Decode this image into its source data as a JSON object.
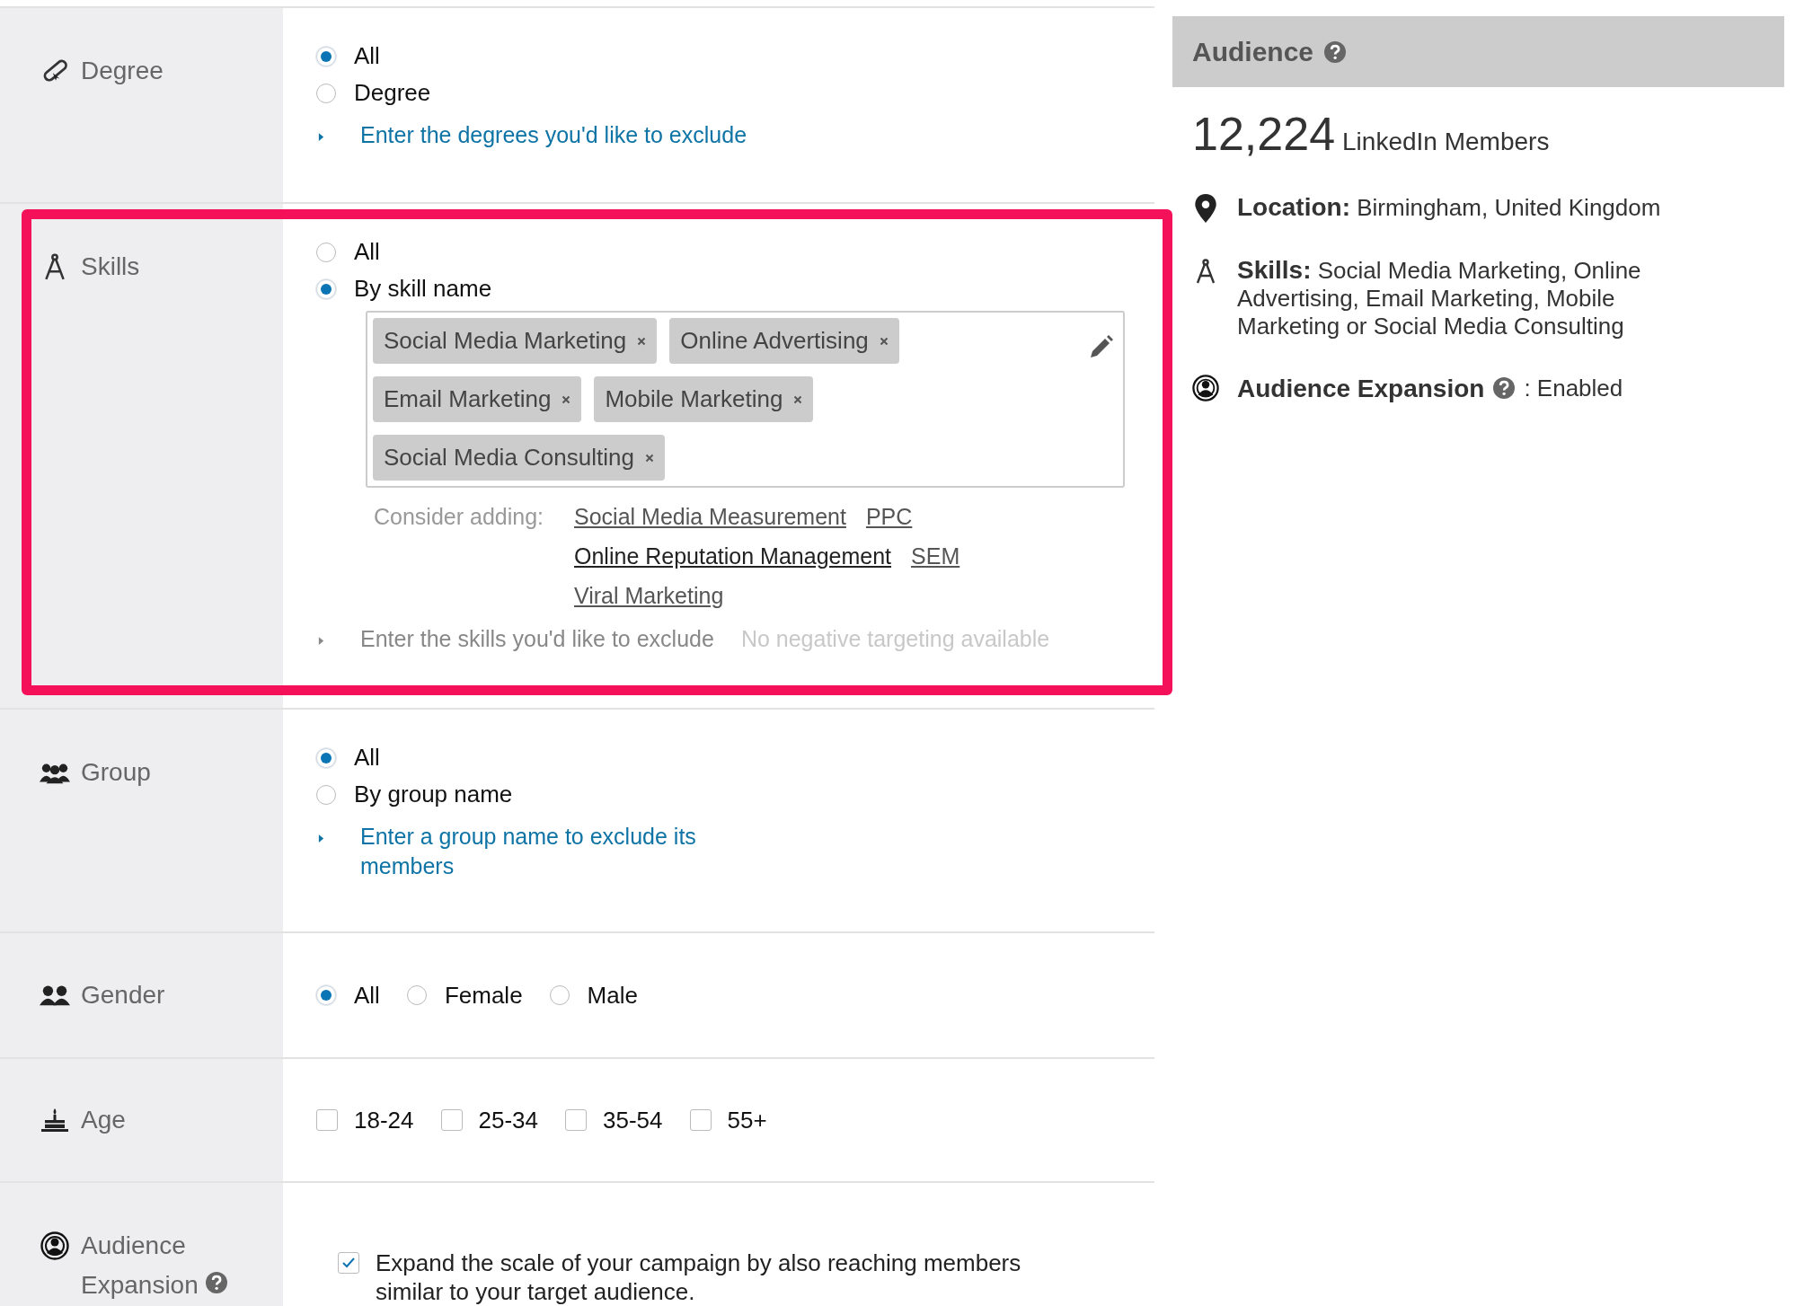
{
  "sections": [
    {
      "kind": "degree",
      "label": "Degree",
      "highlighted": false,
      "options": [
        {
          "label": "All",
          "selected": true
        },
        {
          "label": "Degree",
          "selected": false
        }
      ],
      "exclude": {
        "text": "Enter the degrees you'd like to exclude",
        "disabled": false
      }
    },
    {
      "kind": "skills",
      "label": "Skills",
      "highlighted": true,
      "options": [
        {
          "label": "All",
          "selected": false
        },
        {
          "label": "By skill name",
          "selected": true
        }
      ],
      "tags": [
        "Social Media Marketing",
        "Online Advertising",
        "Email Marketing",
        "Mobile Marketing",
        "Social Media Consulting"
      ],
      "suggestions_label": "Consider adding:",
      "suggestions": [
        {
          "text": "Social Media Measurement",
          "hover": false
        },
        {
          "text": "PPC",
          "hover": false
        },
        {
          "text": "Online Reputation Management",
          "hover": true
        },
        {
          "text": "SEM",
          "hover": false
        },
        {
          "text": "Viral Marketing",
          "hover": false
        }
      ],
      "exclude": {
        "text": "Enter the skills you'd like to exclude",
        "disabled": true
      },
      "exclude_note": "No negative targeting available"
    },
    {
      "kind": "group",
      "label": "Group",
      "highlighted": false,
      "options": [
        {
          "label": "All",
          "selected": true
        },
        {
          "label": "By group name",
          "selected": false
        }
      ],
      "exclude": {
        "text": "Enter a group name to exclude its members",
        "disabled": false
      }
    },
    {
      "kind": "gender",
      "label": "Gender",
      "highlighted": false,
      "options": [
        {
          "label": "All",
          "selected": true
        },
        {
          "label": "Female",
          "selected": false
        },
        {
          "label": "Male",
          "selected": false
        }
      ]
    },
    {
      "kind": "age",
      "label": "Age",
      "highlighted": false,
      "checkboxes": [
        {
          "label": "18-24",
          "checked": false
        },
        {
          "label": "25-34",
          "checked": false
        },
        {
          "label": "35-54",
          "checked": false
        },
        {
          "label": "55+",
          "checked": false
        }
      ]
    },
    {
      "kind": "expansion",
      "label": "Audience Expansion",
      "highlighted": false,
      "checkboxes": [
        {
          "label": "Expand the scale of your campaign by also reaching members similar to your target audience.",
          "checked": true
        }
      ]
    }
  ],
  "audience": {
    "title": "Audience",
    "count": "12,224",
    "count_label": "LinkedIn Members",
    "criteria": [
      {
        "kind": "location",
        "label": "Location:",
        "value": "Birmingham, United Kingdom"
      },
      {
        "kind": "skills",
        "label": "Skills:",
        "value": "Social Media Marketing, Online Advertising, Email Marketing, Mobile Marketing or Social Media Consulting"
      },
      {
        "kind": "expansion",
        "label": "Audience Expansion",
        "value": ": Enabled"
      }
    ]
  }
}
